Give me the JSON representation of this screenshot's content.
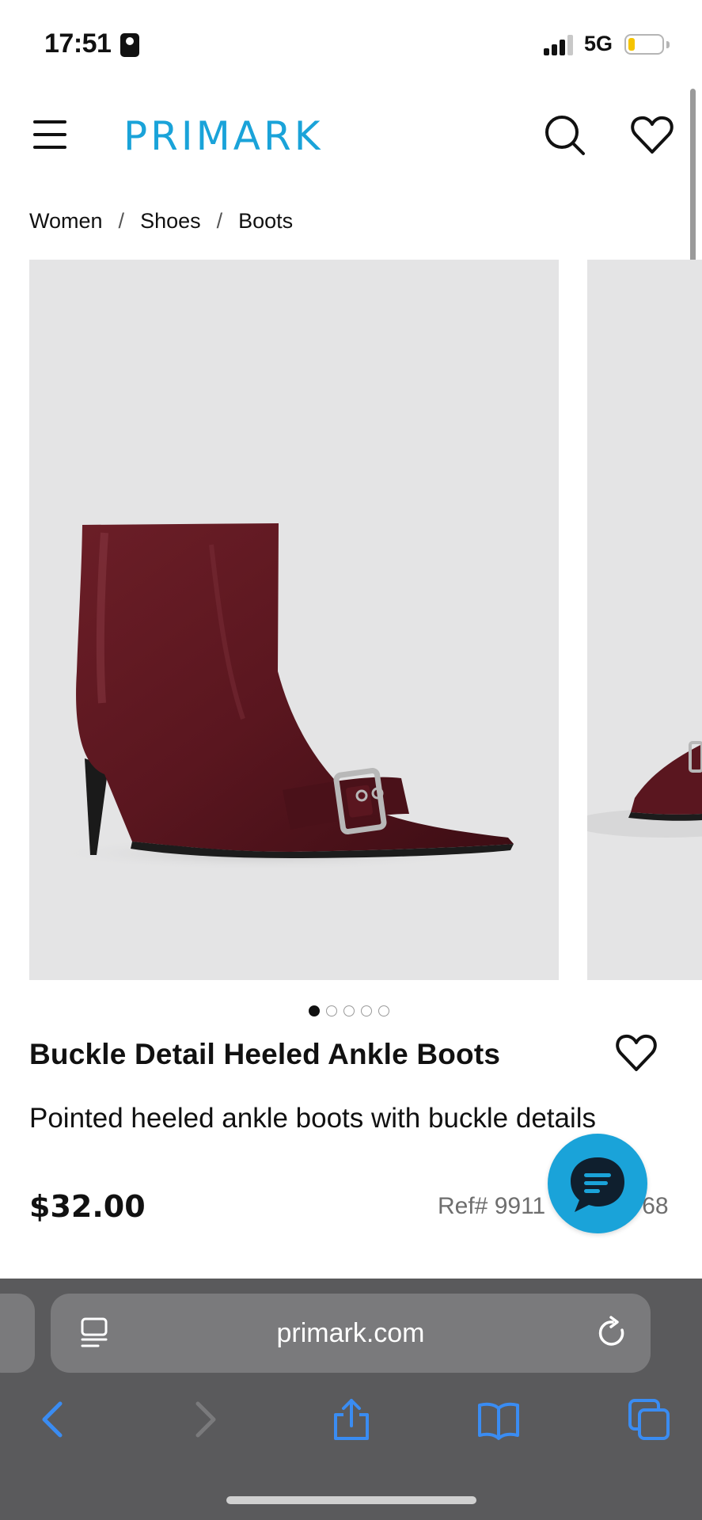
{
  "status_bar": {
    "time": "17:51",
    "network": "5G",
    "battery_level": 0.2
  },
  "header": {
    "brand": "PRIMARK",
    "brand_color": "#1aa3d9"
  },
  "breadcrumb": {
    "items": [
      "Women",
      "Shoes",
      "Boots"
    ],
    "separator": "/"
  },
  "gallery": {
    "image_count": 5,
    "active_index": 0
  },
  "product": {
    "title": "Buckle Detail Heeled Ankle Boots",
    "description": "Pointed heeled ankle boots with buckle details",
    "price": "$32.00",
    "ref": "Ref# 9911",
    "ref_tail": "68"
  },
  "browser": {
    "url": "primark.com",
    "accent_color": "#3a8cf2"
  },
  "icons": {
    "menu": "hamburger-menu-icon",
    "search": "search-icon",
    "wishlist": "heart-icon",
    "chat": "chat-bubble-icon",
    "reader": "reader-mode-icon",
    "reload": "reload-icon",
    "back": "chevron-left-icon",
    "forward": "chevron-right-icon",
    "share": "share-icon",
    "bookmarks": "book-icon",
    "tabs": "tabs-icon"
  }
}
